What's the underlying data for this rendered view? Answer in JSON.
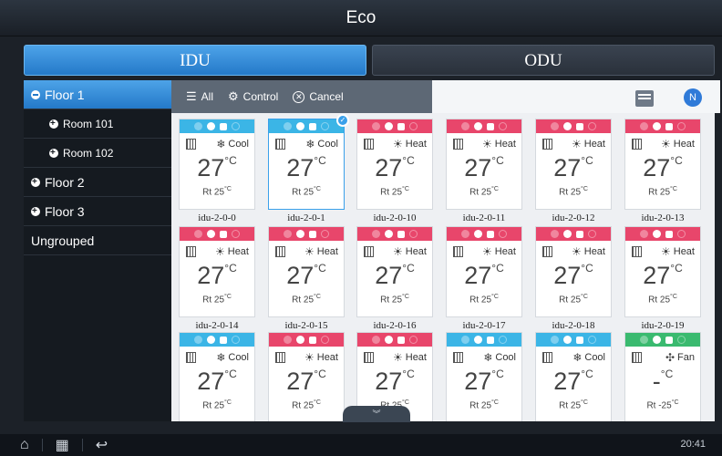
{
  "window": {
    "title": "Eco"
  },
  "tabs": [
    {
      "label": "IDU",
      "active": true
    },
    {
      "label": "ODU",
      "active": false
    }
  ],
  "sidebar": {
    "items": [
      {
        "label": "Floor 1",
        "level": 0,
        "active": true,
        "icon": "minus-circle"
      },
      {
        "label": "Room 101",
        "level": 1,
        "active": false,
        "icon": "plus-circle"
      },
      {
        "label": "Room 102",
        "level": 1,
        "active": false,
        "icon": "plus-circle"
      },
      {
        "label": "Floor 2",
        "level": 0,
        "active": false,
        "icon": "plus-circle"
      },
      {
        "label": "Floor 3",
        "level": 0,
        "active": false,
        "icon": "plus-circle"
      },
      {
        "label": "Ungrouped",
        "level": 0,
        "active": false,
        "icon": ""
      }
    ]
  },
  "toolbar": {
    "all_label": "All",
    "control_label": "Control",
    "cancel_label": "Cancel",
    "badge": "N"
  },
  "units": [
    {
      "name": "idu-2-0-0",
      "mode": "Cool",
      "temp": "27",
      "unit": "°C",
      "rt": "Rt 25",
      "rt_unit": "°C",
      "color": "cool",
      "selected": false
    },
    {
      "name": "idu-2-0-1",
      "mode": "Cool",
      "temp": "27",
      "unit": "°C",
      "rt": "Rt 25",
      "rt_unit": "°C",
      "color": "cool",
      "selected": true
    },
    {
      "name": "idu-2-0-10",
      "mode": "Heat",
      "temp": "27",
      "unit": "°C",
      "rt": "Rt 25",
      "rt_unit": "°C",
      "color": "heat",
      "selected": false
    },
    {
      "name": "idu-2-0-11",
      "mode": "Heat",
      "temp": "27",
      "unit": "°C",
      "rt": "Rt 25",
      "rt_unit": "°C",
      "color": "heat",
      "selected": false
    },
    {
      "name": "idu-2-0-12",
      "mode": "Heat",
      "temp": "27",
      "unit": "°C",
      "rt": "Rt 25",
      "rt_unit": "°C",
      "color": "heat",
      "selected": false
    },
    {
      "name": "idu-2-0-13",
      "mode": "Heat",
      "temp": "27",
      "unit": "°C",
      "rt": "Rt 25",
      "rt_unit": "°C",
      "color": "heat",
      "selected": false
    },
    {
      "name": "idu-2-0-14",
      "mode": "Heat",
      "temp": "27",
      "unit": "°C",
      "rt": "Rt 25",
      "rt_unit": "°C",
      "color": "heat",
      "selected": false
    },
    {
      "name": "idu-2-0-15",
      "mode": "Heat",
      "temp": "27",
      "unit": "°C",
      "rt": "Rt 25",
      "rt_unit": "°C",
      "color": "heat",
      "selected": false
    },
    {
      "name": "idu-2-0-16",
      "mode": "Heat",
      "temp": "27",
      "unit": "°C",
      "rt": "Rt 25",
      "rt_unit": "°C",
      "color": "heat",
      "selected": false
    },
    {
      "name": "idu-2-0-17",
      "mode": "Heat",
      "temp": "27",
      "unit": "°C",
      "rt": "Rt 25",
      "rt_unit": "°C",
      "color": "heat",
      "selected": false
    },
    {
      "name": "idu-2-0-18",
      "mode": "Heat",
      "temp": "27",
      "unit": "°C",
      "rt": "Rt 25",
      "rt_unit": "°C",
      "color": "heat",
      "selected": false
    },
    {
      "name": "idu-2-0-19",
      "mode": "Heat",
      "temp": "27",
      "unit": "°C",
      "rt": "Rt 25",
      "rt_unit": "°C",
      "color": "heat",
      "selected": false
    },
    {
      "name": "",
      "mode": "Cool",
      "temp": "27",
      "unit": "°C",
      "rt": "Rt 25",
      "rt_unit": "°C",
      "color": "cool",
      "selected": false
    },
    {
      "name": "",
      "mode": "Heat",
      "temp": "27",
      "unit": "°C",
      "rt": "Rt 25",
      "rt_unit": "°C",
      "color": "heat",
      "selected": false
    },
    {
      "name": "",
      "mode": "Heat",
      "temp": "27",
      "unit": "°C",
      "rt": "Rt 25",
      "rt_unit": "°C",
      "color": "heat",
      "selected": false
    },
    {
      "name": "",
      "mode": "Cool",
      "temp": "27",
      "unit": "°C",
      "rt": "Rt 25",
      "rt_unit": "°C",
      "color": "cool",
      "selected": false
    },
    {
      "name": "",
      "mode": "Cool",
      "temp": "27",
      "unit": "°C",
      "rt": "Rt 25",
      "rt_unit": "°C",
      "color": "cool",
      "selected": false
    },
    {
      "name": "",
      "mode": "Fan",
      "temp": "-",
      "unit": "°C",
      "rt": "Rt -25",
      "rt_unit": "°C",
      "color": "fan",
      "selected": false
    }
  ],
  "colors": {
    "cool": "#3bb5e6",
    "heat": "#e8466b",
    "fan": "#3aba6f",
    "accent": "#2479c9"
  },
  "statusbar": {
    "time": "20:41"
  }
}
